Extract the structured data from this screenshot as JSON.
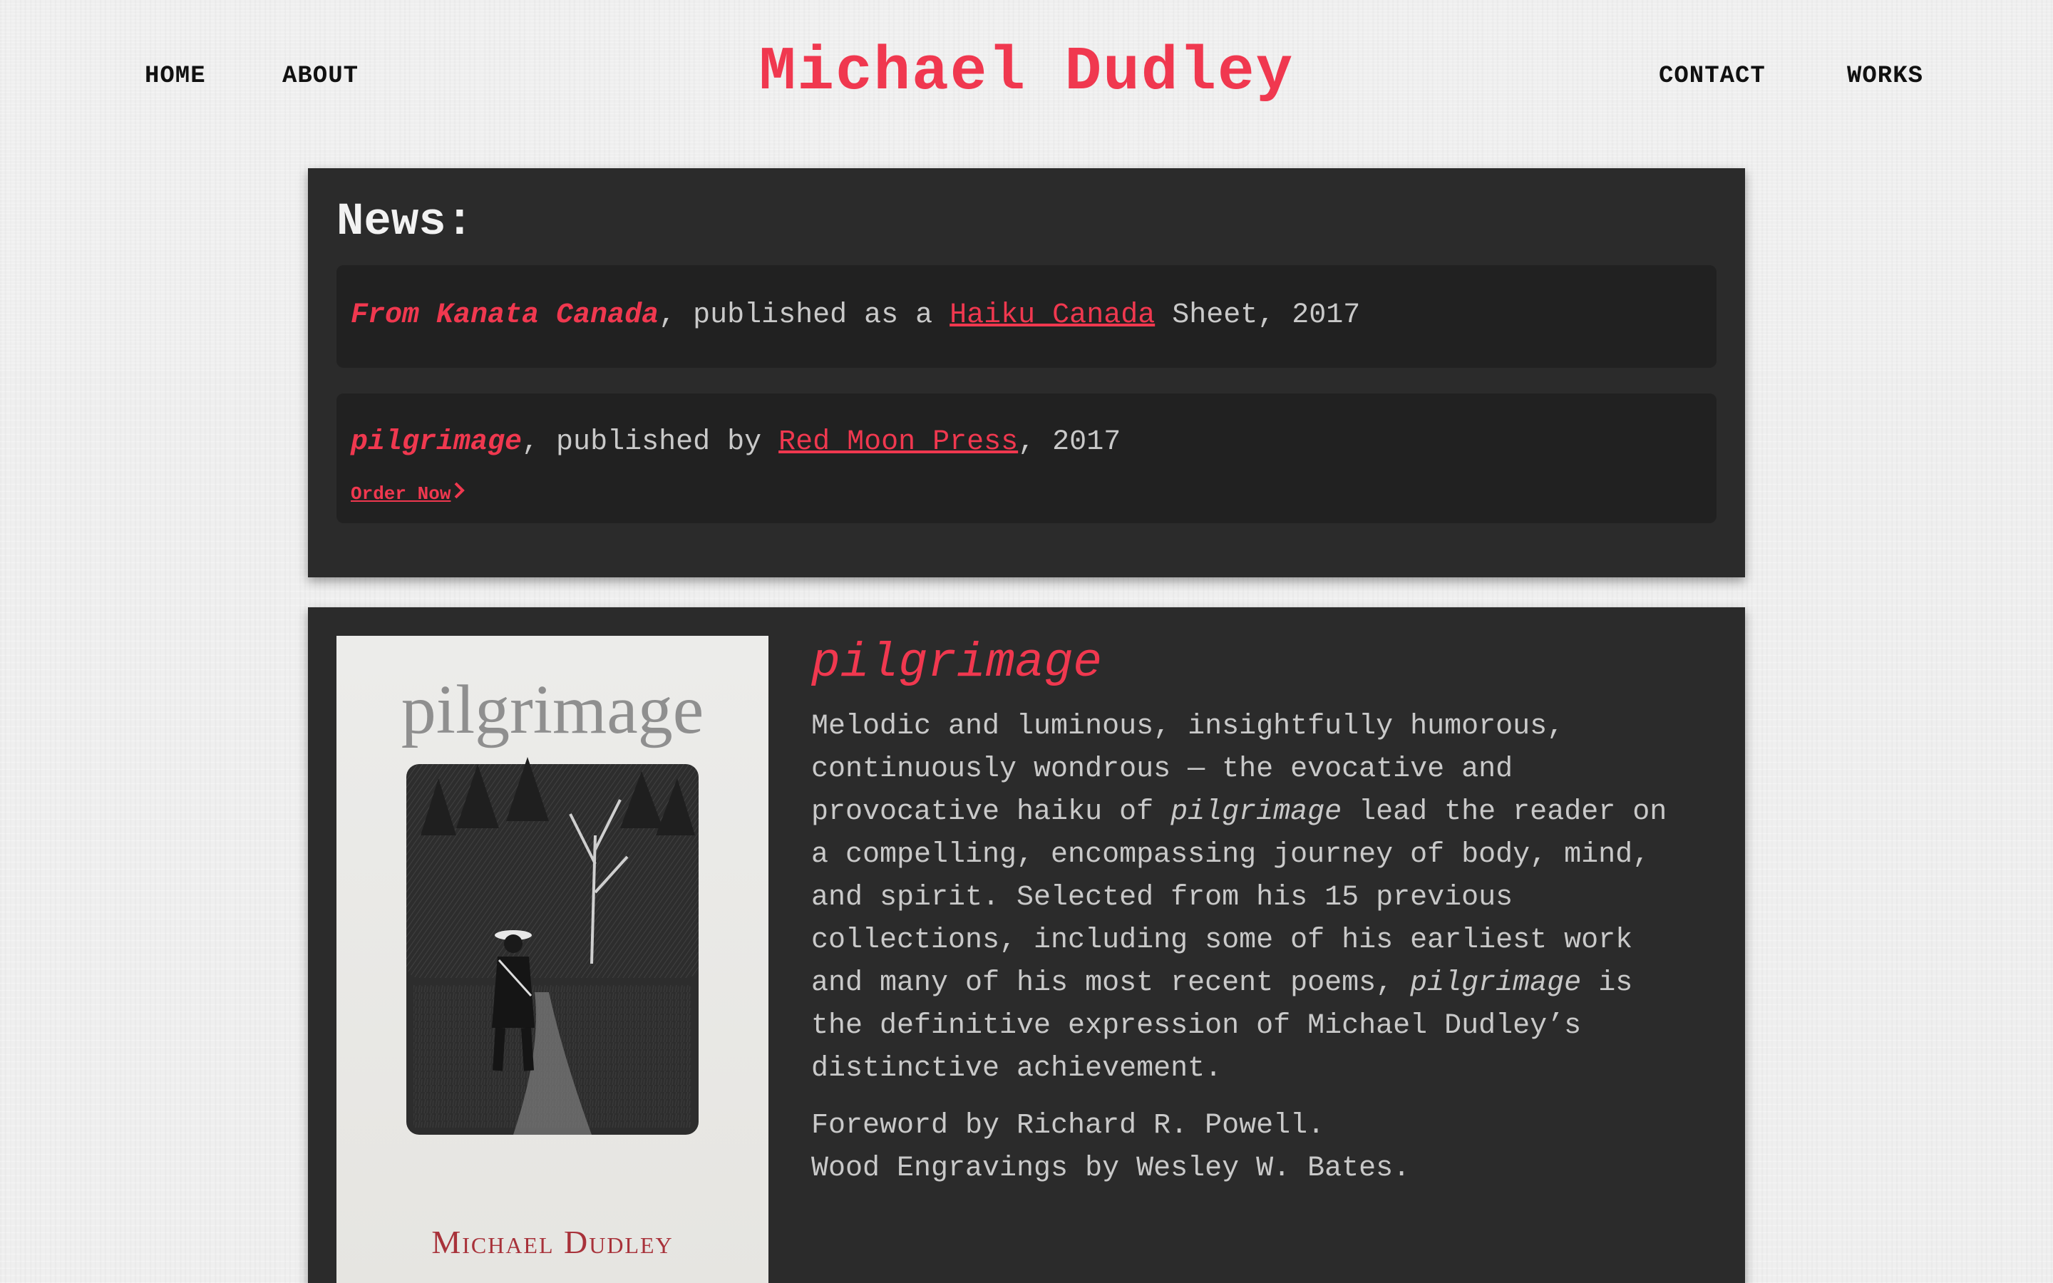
{
  "site": {
    "title": "Michael Dudley",
    "accent_color": "#f0384f",
    "nav_left": [
      "HOME",
      "ABOUT"
    ],
    "nav_right": [
      "CONTACT",
      "WORKS"
    ]
  },
  "news": {
    "heading": "News:",
    "items": [
      {
        "title": "From Kanata Canada",
        "text_before_link": ", published as a ",
        "link": "Haiku Canada",
        "text_after_link": " Sheet, 2017"
      },
      {
        "title": "pilgrimage",
        "text_before_link": ", published by ",
        "link": "Red Moon Press",
        "text_after_link": ", 2017",
        "cta": "Order Now",
        "cta_icon": "chevron-right-icon"
      }
    ]
  },
  "book": {
    "cover_title": "pilgrimage",
    "cover_author": "Michael Dudley",
    "title": "pilgrimage",
    "desc_lines": [
      [
        "Melodic and luminous, insightfully humorous,"
      ],
      [
        "continuously wondrous — the evocative and"
      ],
      [
        "provocative haiku of ",
        "pilgrimage",
        " lead the reader on"
      ],
      [
        "a compelling, encompassing journey of body, mind,"
      ],
      [
        "and spirit. Selected from his 15 previous"
      ],
      [
        "collections, including some of his earliest work"
      ],
      [
        "and many of his most recent poems, ",
        "pilgrimage",
        " is"
      ],
      [
        "the definitive expression of Michael Dudley’s"
      ],
      [
        "distinctive achievement."
      ]
    ],
    "credits": [
      "Foreword by Richard R. Powell.",
      "Wood Engravings by Wesley W. Bates."
    ]
  }
}
